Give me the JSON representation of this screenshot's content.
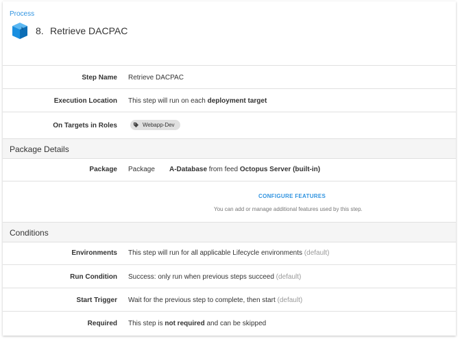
{
  "breadcrumb": "Process",
  "step": {
    "number": "8.",
    "title": "Retrieve DACPAC",
    "icon": "package-box-icon"
  },
  "rows": {
    "step_name": {
      "label": "Step Name",
      "value": "Retrieve DACPAC"
    },
    "execution_location": {
      "label": "Execution Location",
      "text": "This step will run on each ",
      "bold": "deployment target"
    },
    "on_targets": {
      "label": "On Targets in Roles",
      "role": "Webapp-Dev"
    }
  },
  "package_section": {
    "title": "Package Details",
    "package": {
      "label": "Package",
      "prefix": "Package",
      "name": "A-Database",
      "mid": " from feed ",
      "feed": "Octopus Server (built-in)"
    },
    "configure": {
      "button": "CONFIGURE FEATURES",
      "help": "You can add or manage additional features used by this step."
    }
  },
  "conditions": {
    "title": "Conditions",
    "environments": {
      "label": "Environments",
      "text": "This step will run for all applicable Lifecycle environments",
      "default": "(default)"
    },
    "run_condition": {
      "label": "Run Condition",
      "text": "Success: only run when previous steps succeed",
      "default": "(default)"
    },
    "start_trigger": {
      "label": "Start Trigger",
      "text": "Wait for the previous step to complete, then start",
      "default": "(default)"
    },
    "required": {
      "label": "Required",
      "pre": "This step is ",
      "bold": "not required",
      "post": " and can be skipped"
    }
  },
  "colors": {
    "accent": "#2f93e0",
    "icon_blue": "#1a8fe0",
    "section_bg": "#f5f5f5"
  }
}
